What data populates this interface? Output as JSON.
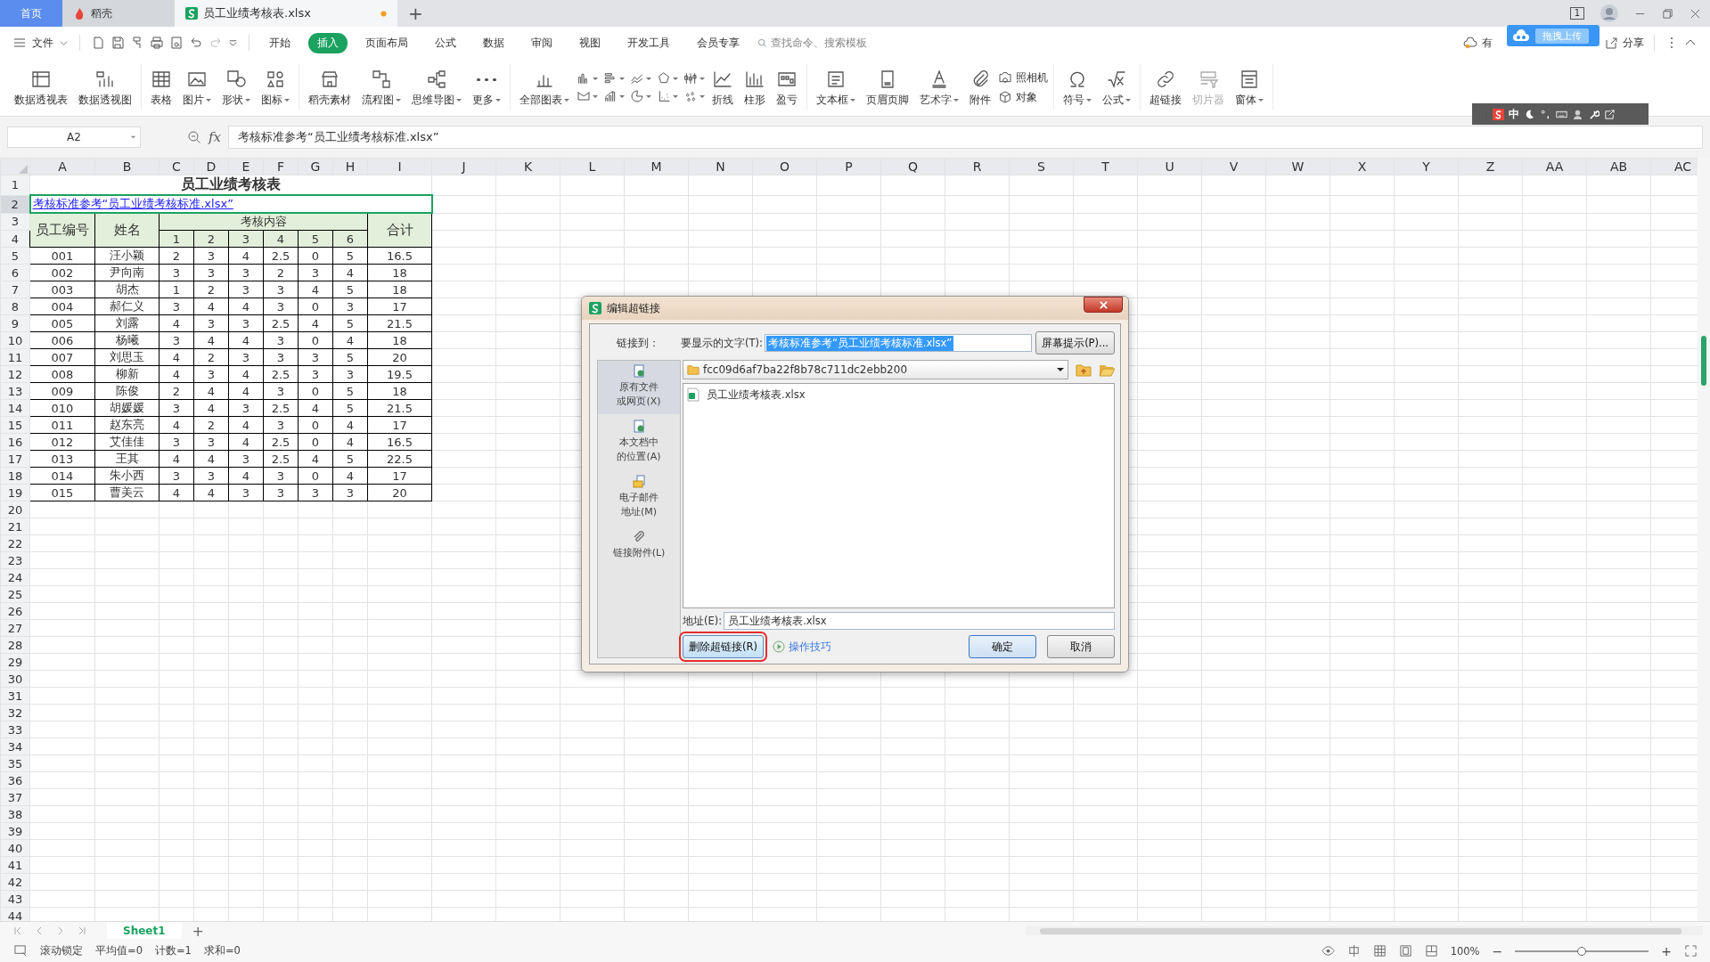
{
  "title_bar": {
    "tabs": [
      {
        "label": "首页",
        "kind": "home",
        "selected": false,
        "unsaved": false
      },
      {
        "label": "稻壳",
        "kind": "docer",
        "selected": false,
        "unsaved": false
      },
      {
        "label": "员工业绩考核表.xlsx",
        "kind": "sheet",
        "selected": true,
        "unsaved": true
      }
    ],
    "new_tab": "+",
    "window_count": "1"
  },
  "menu_bar": {
    "file": "文件",
    "tabs": [
      {
        "label": "开始",
        "selected": false
      },
      {
        "label": "插入",
        "selected": true
      },
      {
        "label": "页面布局",
        "selected": false
      },
      {
        "label": "公式",
        "selected": false
      },
      {
        "label": "数据",
        "selected": false
      },
      {
        "label": "审阅",
        "selected": false
      },
      {
        "label": "视图",
        "selected": false
      },
      {
        "label": "开发工具",
        "selected": false
      },
      {
        "label": "会员专享",
        "selected": false
      }
    ],
    "search": {
      "placeholder": "查找命令、搜索模板"
    },
    "cloud_label": "有",
    "upload_popup": "拖拽上传",
    "share": "分享"
  },
  "ribbon": {
    "groups": [
      [
        {
          "kind": "large",
          "label": "数据透视表",
          "dropdown": false,
          "disabled": false
        },
        {
          "kind": "large",
          "label": "数据透视图",
          "dropdown": false,
          "disabled": false
        }
      ],
      [
        {
          "kind": "large",
          "label": "表格",
          "dropdown": false,
          "disabled": false
        },
        {
          "kind": "large",
          "label": "图片",
          "dropdown": true,
          "disabled": false
        },
        {
          "kind": "large",
          "label": "形状",
          "dropdown": true,
          "disabled": false
        },
        {
          "kind": "large",
          "label": "图标",
          "dropdown": true,
          "disabled": false
        }
      ],
      [
        {
          "kind": "large",
          "label": "稻壳素材",
          "dropdown": false,
          "disabled": false
        },
        {
          "kind": "large",
          "label": "流程图",
          "dropdown": true,
          "disabled": false
        },
        {
          "kind": "large",
          "label": "思维导图",
          "dropdown": true,
          "disabled": false
        },
        {
          "kind": "large",
          "label": "更多",
          "dropdown": true,
          "disabled": false
        }
      ],
      [
        {
          "kind": "large",
          "label": "全部图表",
          "dropdown": true,
          "disabled": false
        },
        {
          "kind": "grid",
          "buttons": [
            {
              "dropdown": true
            },
            {
              "dropdown": true
            },
            {
              "dropdown": true
            },
            {
              "dropdown": true
            },
            {
              "dropdown": true
            },
            {
              "dropdown": true
            },
            {
              "dropdown": true
            },
            {
              "dropdown": true
            },
            {
              "dropdown": true
            },
            {
              "dropdown": true
            }
          ]
        },
        {
          "kind": "large",
          "label": "折线",
          "dropdown": false,
          "disabled": false
        },
        {
          "kind": "large",
          "label": "柱形",
          "dropdown": false,
          "disabled": false
        },
        {
          "kind": "large",
          "label": "盈亏",
          "dropdown": false,
          "disabled": false
        }
      ],
      [
        {
          "kind": "large",
          "label": "文本框",
          "dropdown": true,
          "disabled": false
        },
        {
          "kind": "large",
          "label": "页眉页脚",
          "dropdown": false,
          "disabled": false
        },
        {
          "kind": "large",
          "label": "艺术字",
          "dropdown": true,
          "disabled": false
        },
        {
          "kind": "large",
          "label": "附件",
          "dropdown": false,
          "disabled": false
        },
        {
          "kind": "stack",
          "buttons": [
            {
              "label": "照相机"
            },
            {
              "label": "对象"
            }
          ]
        }
      ],
      [
        {
          "kind": "large",
          "label": "符号",
          "dropdown": true,
          "disabled": false
        },
        {
          "kind": "large",
          "label": "公式",
          "dropdown": true,
          "disabled": false
        }
      ],
      [
        {
          "kind": "large",
          "label": "超链接",
          "dropdown": false,
          "disabled": false
        },
        {
          "kind": "large",
          "label": "切片器",
          "dropdown": false,
          "disabled": true
        },
        {
          "kind": "large",
          "label": "窗体",
          "dropdown": true,
          "disabled": false
        }
      ]
    ]
  },
  "ime_bar": {
    "mode": "中"
  },
  "formula_bar": {
    "name_box": "A2",
    "fx": "fx",
    "value": "考核标准参考“员工业绩考核标准.xlsx”"
  },
  "sheet": {
    "columns": [
      "A",
      "B",
      "C",
      "D",
      "E",
      "F",
      "G",
      "H",
      "I",
      "J",
      "K",
      "L",
      "M",
      "N",
      "O",
      "P",
      "Q",
      "R",
      "S",
      "T",
      "U",
      "V",
      "W",
      "X",
      "Y",
      "Z",
      "AA",
      "AB",
      "AC"
    ],
    "rows": [
      {
        "label": "1",
        "selected": false
      },
      {
        "label": "2",
        "selected": true
      },
      {
        "label": "3",
        "selected": false
      },
      {
        "label": "4",
        "selected": false
      },
      {
        "label": "5",
        "selected": false
      },
      {
        "label": "6",
        "selected": false
      },
      {
        "label": "7",
        "selected": false
      },
      {
        "label": "8",
        "selected": false
      },
      {
        "label": "9",
        "selected": false
      },
      {
        "label": "10",
        "selected": false
      },
      {
        "label": "11",
        "selected": false
      },
      {
        "label": "12",
        "selected": false
      },
      {
        "label": "13",
        "selected": false
      },
      {
        "label": "14",
        "selected": false
      },
      {
        "label": "15",
        "selected": false
      },
      {
        "label": "16",
        "selected": false
      },
      {
        "label": "17",
        "selected": false
      },
      {
        "label": "18",
        "selected": false
      },
      {
        "label": "19",
        "selected": false
      },
      {
        "label": "20",
        "selected": false
      },
      {
        "label": "21",
        "selected": false
      },
      {
        "label": "22",
        "selected": false
      },
      {
        "label": "23",
        "selected": false
      },
      {
        "label": "24",
        "selected": false
      },
      {
        "label": "25",
        "selected": false
      },
      {
        "label": "26",
        "selected": false
      },
      {
        "label": "27",
        "selected": false
      },
      {
        "label": "28",
        "selected": false
      },
      {
        "label": "29",
        "selected": false
      },
      {
        "label": "30",
        "selected": false
      },
      {
        "label": "31",
        "selected": false
      },
      {
        "label": "32",
        "selected": false
      },
      {
        "label": "33",
        "selected": false
      },
      {
        "label": "34",
        "selected": false
      },
      {
        "label": "35",
        "selected": false
      },
      {
        "label": "36",
        "selected": false
      },
      {
        "label": "37",
        "selected": false
      },
      {
        "label": "38",
        "selected": false
      },
      {
        "label": "39",
        "selected": false
      },
      {
        "label": "40",
        "selected": false
      },
      {
        "label": "41",
        "selected": false
      },
      {
        "label": "42",
        "selected": false
      },
      {
        "label": "43",
        "selected": false
      },
      {
        "label": "44",
        "selected": false
      }
    ],
    "title": "员工业绩考核表",
    "link": {
      "text": "考核标准参考“员工业绩考核标准.xlsx”",
      "selected": true
    },
    "headers": {
      "id": "员工编号",
      "name": "姓名",
      "group": "考核内容",
      "items": [
        "1",
        "2",
        "3",
        "4",
        "5",
        "6"
      ],
      "total": "合计"
    },
    "records": [
      {
        "id": "001",
        "name": "汪小颖",
        "scores": [
          "2",
          "3",
          "4",
          "2.5",
          "0",
          "5"
        ],
        "total": "16.5"
      },
      {
        "id": "002",
        "name": "尹向南",
        "scores": [
          "3",
          "3",
          "3",
          "2",
          "3",
          "4"
        ],
        "total": "18"
      },
      {
        "id": "003",
        "name": "胡杰",
        "scores": [
          "1",
          "2",
          "3",
          "3",
          "4",
          "5"
        ],
        "total": "18"
      },
      {
        "id": "004",
        "name": "郝仁义",
        "scores": [
          "3",
          "4",
          "4",
          "3",
          "0",
          "3"
        ],
        "total": "17"
      },
      {
        "id": "005",
        "name": "刘露",
        "scores": [
          "4",
          "3",
          "3",
          "2.5",
          "4",
          "5"
        ],
        "total": "21.5"
      },
      {
        "id": "006",
        "name": "杨曦",
        "scores": [
          "3",
          "4",
          "4",
          "3",
          "0",
          "4"
        ],
        "total": "18"
      },
      {
        "id": "007",
        "name": "刘思玉",
        "scores": [
          "4",
          "2",
          "3",
          "3",
          "3",
          "5"
        ],
        "total": "20"
      },
      {
        "id": "008",
        "name": "柳新",
        "scores": [
          "4",
          "3",
          "4",
          "2.5",
          "3",
          "3"
        ],
        "total": "19.5"
      },
      {
        "id": "009",
        "name": "陈俊",
        "scores": [
          "2",
          "4",
          "4",
          "3",
          "0",
          "5"
        ],
        "total": "18"
      },
      {
        "id": "010",
        "name": "胡媛媛",
        "scores": [
          "3",
          "4",
          "3",
          "2.5",
          "4",
          "5"
        ],
        "total": "21.5"
      },
      {
        "id": "011",
        "name": "赵东亮",
        "scores": [
          "4",
          "2",
          "4",
          "3",
          "0",
          "4"
        ],
        "total": "17"
      },
      {
        "id": "012",
        "name": "艾佳佳",
        "scores": [
          "3",
          "3",
          "4",
          "2.5",
          "0",
          "4"
        ],
        "total": "16.5"
      },
      {
        "id": "013",
        "name": "王其",
        "scores": [
          "4",
          "4",
          "3",
          "2.5",
          "4",
          "5"
        ],
        "total": "22.5"
      },
      {
        "id": "014",
        "name": "朱小西",
        "scores": [
          "3",
          "3",
          "4",
          "3",
          "0",
          "4"
        ],
        "total": "17"
      },
      {
        "id": "015",
        "name": "曹美云",
        "scores": [
          "4",
          "4",
          "3",
          "3",
          "3",
          "3"
        ],
        "total": "20"
      }
    ]
  },
  "dialog": {
    "title": "编辑超链接",
    "link_to": "链接到：",
    "display_label": "要显示的文字(T):",
    "display_value": "考核标准参考“员工业绩考核标准.xlsx”",
    "screen_tip": "屏幕提示(P)...",
    "sidebar": [
      {
        "lines": [
          "原有文件",
          "或网页(X)"
        ],
        "selected": true
      },
      {
        "lines": [
          "本文档中",
          "的位置(A)"
        ],
        "selected": false
      },
      {
        "lines": [
          "电子邮件",
          "地址(M)"
        ],
        "selected": false
      },
      {
        "lines": [
          "链接附件(L)"
        ],
        "selected": false
      }
    ],
    "folder": "fcc09d6af7ba22f8b78c711dc2ebb200",
    "files": [
      "员工业绩考核表.xlsx"
    ],
    "address_label": "地址(E):",
    "address_value": "员工业绩考核表.xlsx",
    "remove_button": {
      "label": "删除超链接(R)",
      "highlighted": true
    },
    "tips_link": "操作技巧",
    "ok": "确定",
    "cancel": "取消"
  },
  "sheet_bar": {
    "tabs": [
      {
        "label": "Sheet1",
        "selected": true
      }
    ],
    "add": "+"
  },
  "status_bar": {
    "scroll_lock": "滚动锁定",
    "stats": [
      "平均值=0",
      "计数=1",
      "求和=0"
    ],
    "zoom": "100%",
    "zoom_out": "−",
    "zoom_in": "+",
    "zoom_slider": {
      "level": 0.5
    }
  }
}
